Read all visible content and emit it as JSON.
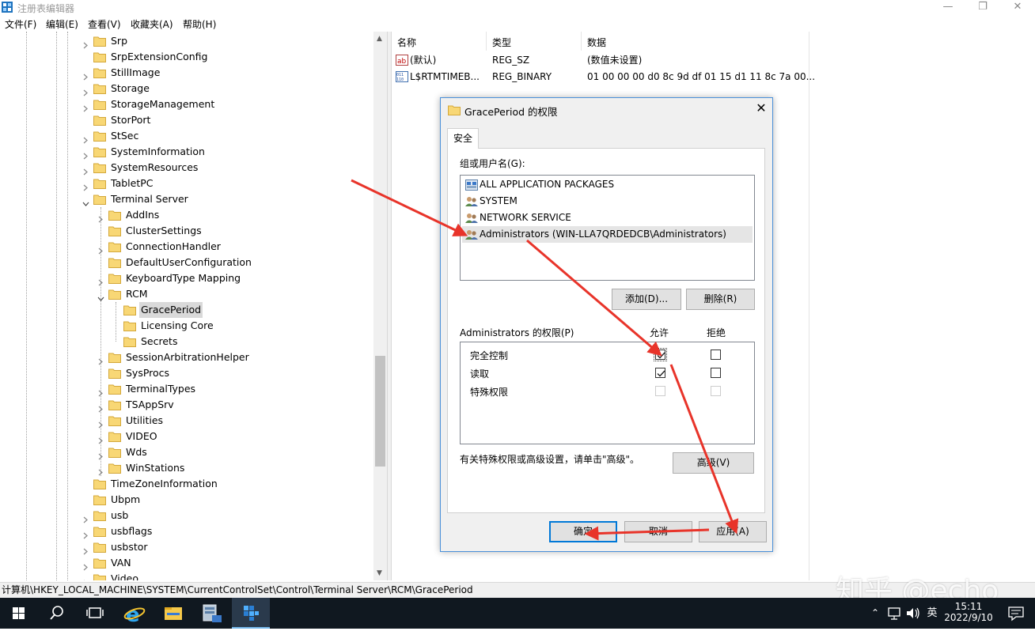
{
  "window": {
    "title": "注册表编辑器"
  },
  "menu": [
    "文件(F)",
    "编辑(E)",
    "查看(V)",
    "收藏夹(A)",
    "帮助(H)"
  ],
  "tree": [
    {
      "label": "Srp",
      "level": 0,
      "exp": ">"
    },
    {
      "label": "SrpExtensionConfig",
      "level": 0,
      "exp": ""
    },
    {
      "label": "StillImage",
      "level": 0,
      "exp": ">"
    },
    {
      "label": "Storage",
      "level": 0,
      "exp": ">"
    },
    {
      "label": "StorageManagement",
      "level": 0,
      "exp": ">"
    },
    {
      "label": "StorPort",
      "level": 0,
      "exp": ""
    },
    {
      "label": "StSec",
      "level": 0,
      "exp": ">"
    },
    {
      "label": "SystemInformation",
      "level": 0,
      "exp": ">"
    },
    {
      "label": "SystemResources",
      "level": 0,
      "exp": ">"
    },
    {
      "label": "TabletPC",
      "level": 0,
      "exp": ">"
    },
    {
      "label": "Terminal Server",
      "level": 0,
      "exp": "v"
    },
    {
      "label": "AddIns",
      "level": 1,
      "exp": ">"
    },
    {
      "label": "ClusterSettings",
      "level": 1,
      "exp": ""
    },
    {
      "label": "ConnectionHandler",
      "level": 1,
      "exp": ">"
    },
    {
      "label": "DefaultUserConfiguration",
      "level": 1,
      "exp": ""
    },
    {
      "label": "KeyboardType Mapping",
      "level": 1,
      "exp": ">"
    },
    {
      "label": "RCM",
      "level": 1,
      "exp": "v"
    },
    {
      "label": "GracePeriod",
      "level": 2,
      "exp": "",
      "sel": true
    },
    {
      "label": "Licensing Core",
      "level": 2,
      "exp": ""
    },
    {
      "label": "Secrets",
      "level": 2,
      "exp": ""
    },
    {
      "label": "SessionArbitrationHelper",
      "level": 1,
      "exp": ">"
    },
    {
      "label": "SysProcs",
      "level": 1,
      "exp": ""
    },
    {
      "label": "TerminalTypes",
      "level": 1,
      "exp": ">"
    },
    {
      "label": "TSAppSrv",
      "level": 1,
      "exp": ">"
    },
    {
      "label": "Utilities",
      "level": 1,
      "exp": ">"
    },
    {
      "label": "VIDEO",
      "level": 1,
      "exp": ">"
    },
    {
      "label": "Wds",
      "level": 1,
      "exp": ">"
    },
    {
      "label": "WinStations",
      "level": 1,
      "exp": ">"
    },
    {
      "label": "TimeZoneInformation",
      "level": 0,
      "exp": ""
    },
    {
      "label": "Ubpm",
      "level": 0,
      "exp": ""
    },
    {
      "label": "usb",
      "level": 0,
      "exp": ">"
    },
    {
      "label": "usbflags",
      "level": 0,
      "exp": ">"
    },
    {
      "label": "usbstor",
      "level": 0,
      "exp": ">"
    },
    {
      "label": "VAN",
      "level": 0,
      "exp": ">"
    },
    {
      "label": "Video",
      "level": 0,
      "exp": ">"
    }
  ],
  "values": {
    "headers": [
      "名称",
      "类型",
      "数据"
    ],
    "rows": [
      {
        "name": "(默认)",
        "type": "REG_SZ",
        "data": "(数值未设置)",
        "icon": "string-value-icon"
      },
      {
        "name": "L$RTMTIMEB...",
        "type": "REG_BINARY",
        "data": "01 00 00 00 d0 8c 9d df 01 15 d1 11 8c 7a 00...",
        "icon": "binary-value-icon"
      }
    ]
  },
  "status": "计算机\\HKEY_LOCAL_MACHINE\\SYSTEM\\CurrentControlSet\\Control\\Terminal Server\\RCM\\GracePeriod",
  "watermark": "知乎 @echo",
  "dialog": {
    "title": "GracePeriod 的权限",
    "tab": "安全",
    "groups_label": "组或用户名(G):",
    "users": [
      {
        "name": "ALL APPLICATION PACKAGES",
        "icon": "app-packages-icon"
      },
      {
        "name": "SYSTEM",
        "icon": "user-group-icon"
      },
      {
        "name": "NETWORK SERVICE",
        "icon": "user-group-icon"
      },
      {
        "name": "Administrators (WIN-LLA7QRDEDCB\\Administrators)",
        "icon": "user-group-icon",
        "sel": true
      }
    ],
    "add_button": "添加(D)...",
    "remove_button": "删除(R)",
    "perm_label": "Administrators 的权限(P)",
    "allow_header": "允许",
    "deny_header": "拒绝",
    "permissions": [
      {
        "name": "完全控制",
        "allow": true,
        "deny": false,
        "disabled": false
      },
      {
        "name": "读取",
        "allow": true,
        "deny": false,
        "disabled": false
      },
      {
        "name": "特殊权限",
        "allow": false,
        "deny": false,
        "disabled": true
      }
    ],
    "advanced_text": "有关特殊权限或高级设置，请单击\"高级\"。",
    "advanced_button": "高级(V)",
    "ok_button": "确定",
    "cancel_button": "取消",
    "apply_button": "应用(A)"
  },
  "taskbar": {
    "time": "15:11",
    "date": "2022/9/10",
    "ime": "英"
  },
  "colors": {
    "accent": "#0078d7",
    "arrow": "#e8342a",
    "taskbar": "#101820",
    "folder": "#f8d775"
  }
}
